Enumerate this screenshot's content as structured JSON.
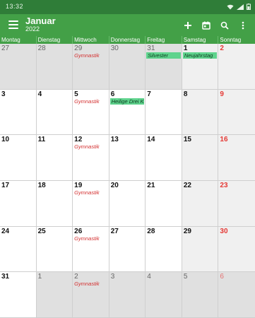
{
  "status": {
    "time": "13:32"
  },
  "header": {
    "month": "Januar",
    "year": "2022"
  },
  "weekdays": [
    "Montag",
    "Dienstag",
    "Mittwoch",
    "Donnerstag",
    "Freitag",
    "Samstag",
    "Sonntag"
  ],
  "days": [
    {
      "num": "27"
    },
    {
      "num": "28"
    },
    {
      "num": "29",
      "event": "Gymnastik"
    },
    {
      "num": "30"
    },
    {
      "num": "31",
      "event": "Silvester"
    },
    {
      "num": "1",
      "event": "Neujahrstag"
    },
    {
      "num": "2"
    },
    {
      "num": "3"
    },
    {
      "num": "4"
    },
    {
      "num": "5",
      "event": "Gymnastik"
    },
    {
      "num": "6",
      "event": "Heilige Drei Kö"
    },
    {
      "num": "7"
    },
    {
      "num": "8"
    },
    {
      "num": "9"
    },
    {
      "num": "10"
    },
    {
      "num": "11"
    },
    {
      "num": "12",
      "event": "Gymnastik"
    },
    {
      "num": "13"
    },
    {
      "num": "14"
    },
    {
      "num": "15"
    },
    {
      "num": "16"
    },
    {
      "num": "17"
    },
    {
      "num": "18"
    },
    {
      "num": "19",
      "event": "Gymnastik"
    },
    {
      "num": "20"
    },
    {
      "num": "21"
    },
    {
      "num": "22"
    },
    {
      "num": "23"
    },
    {
      "num": "24"
    },
    {
      "num": "25"
    },
    {
      "num": "26",
      "event": "Gymnastik"
    },
    {
      "num": "27"
    },
    {
      "num": "28"
    },
    {
      "num": "29"
    },
    {
      "num": "30"
    },
    {
      "num": "31"
    },
    {
      "num": "1"
    },
    {
      "num": "2",
      "event": "Gymnastik"
    },
    {
      "num": "3"
    },
    {
      "num": "4"
    },
    {
      "num": "5"
    },
    {
      "num": "6"
    }
  ],
  "colors": {
    "statusbar": "#2f7d38",
    "appbar": "#43a047",
    "holiday_chip": "#5fd38d",
    "gym_text": "#d32f2f",
    "sunday": "#e53935"
  },
  "icons": [
    "menu-icon",
    "add-icon",
    "calendar-today-icon",
    "search-icon",
    "more-vert-icon"
  ]
}
